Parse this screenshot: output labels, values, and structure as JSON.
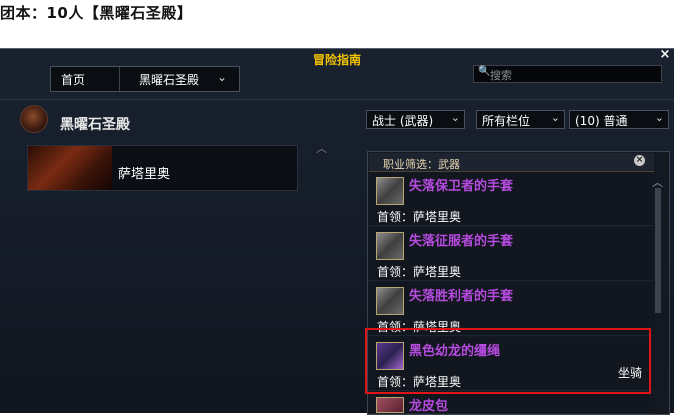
{
  "caption": "团本：10人【黑曜石圣殿】",
  "window": {
    "title": "冒险指南",
    "close": "×"
  },
  "nav": {
    "home": "首页",
    "crumb": "黑曜石圣殿"
  },
  "search": {
    "placeholder": "搜索"
  },
  "instance": {
    "name": "黑曜石圣殿"
  },
  "bosses": [
    {
      "name": "萨塔里奥"
    }
  ],
  "filters": {
    "class": "战士 (武器)",
    "slot": "所有栏位",
    "difficulty": "(10) 普通"
  },
  "loot": {
    "filter_label": "职业筛选：武器",
    "items": [
      {
        "name": "失落保卫者的手套",
        "boss": "首领：萨塔里奥",
        "slot": ""
      },
      {
        "name": "失落征服者的手套",
        "boss": "首领：萨塔里奥",
        "slot": ""
      },
      {
        "name": "失落胜利者的手套",
        "boss": "首领：萨塔里奥",
        "slot": ""
      },
      {
        "name": "黑色幼龙的缰绳",
        "boss": "首领：萨塔里奥",
        "slot": "坐骑"
      },
      {
        "name": "龙皮包",
        "boss": "",
        "slot": ""
      }
    ]
  },
  "colors": {
    "title": "#f2c400",
    "item_epic": "#b64be0",
    "highlight": "#e01515"
  }
}
